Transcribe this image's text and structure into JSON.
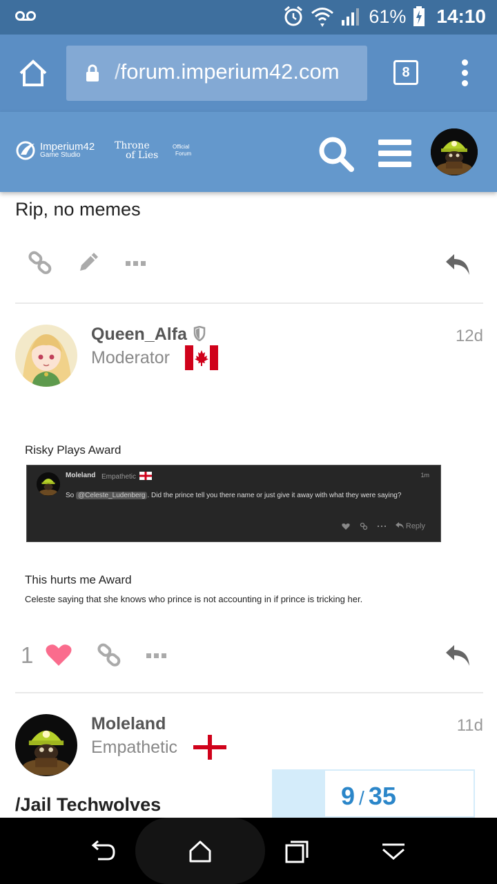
{
  "status_bar": {
    "battery": "61%",
    "time": "14:10"
  },
  "browser": {
    "url_prefix": "/",
    "url": "forum.imperium42.com",
    "tab_count": "8"
  },
  "site_header": {
    "logo1_name": "Imperium42",
    "logo1_sub": "Game Studio",
    "logo2_line1": "Throne",
    "logo2_line2": "of Lies",
    "logo3_line1": "Official",
    "logo3_line2": "Forum"
  },
  "posts": [
    {
      "text": "Rip, no memes"
    },
    {
      "author": "Queen_Alfa",
      "title": "Moderator",
      "date": "12d",
      "award1_title": "Risky Plays Award",
      "embed": {
        "name": "Moleland",
        "title": "Empathetic",
        "time": "1m",
        "text_before": "So ",
        "mention": "@Celeste_Ludenberg",
        "text_after": ". Did the prince tell you there name or just give it away with what they were saying?",
        "reply_label": "Reply"
      },
      "award2_title": "This hurts me Award",
      "award2_text": "Celeste saying that she knows who prince is not accounting in if prince is tricking her.",
      "like_count": "1"
    },
    {
      "author": "Moleland",
      "title": "Empathetic",
      "date": "11d",
      "text": "/Jail Techwolves"
    }
  ],
  "progress": {
    "current": "9",
    "separator": "/",
    "total": "35",
    "fraction": 0.257
  },
  "colors": {
    "status_bar": "#3e6f9e",
    "browser_bar": "#5b8ec4",
    "site_header": "#6498cc",
    "like": "#fa6c8d",
    "progress_text": "#2b86c9",
    "progress_fill": "#d4ecfa"
  }
}
